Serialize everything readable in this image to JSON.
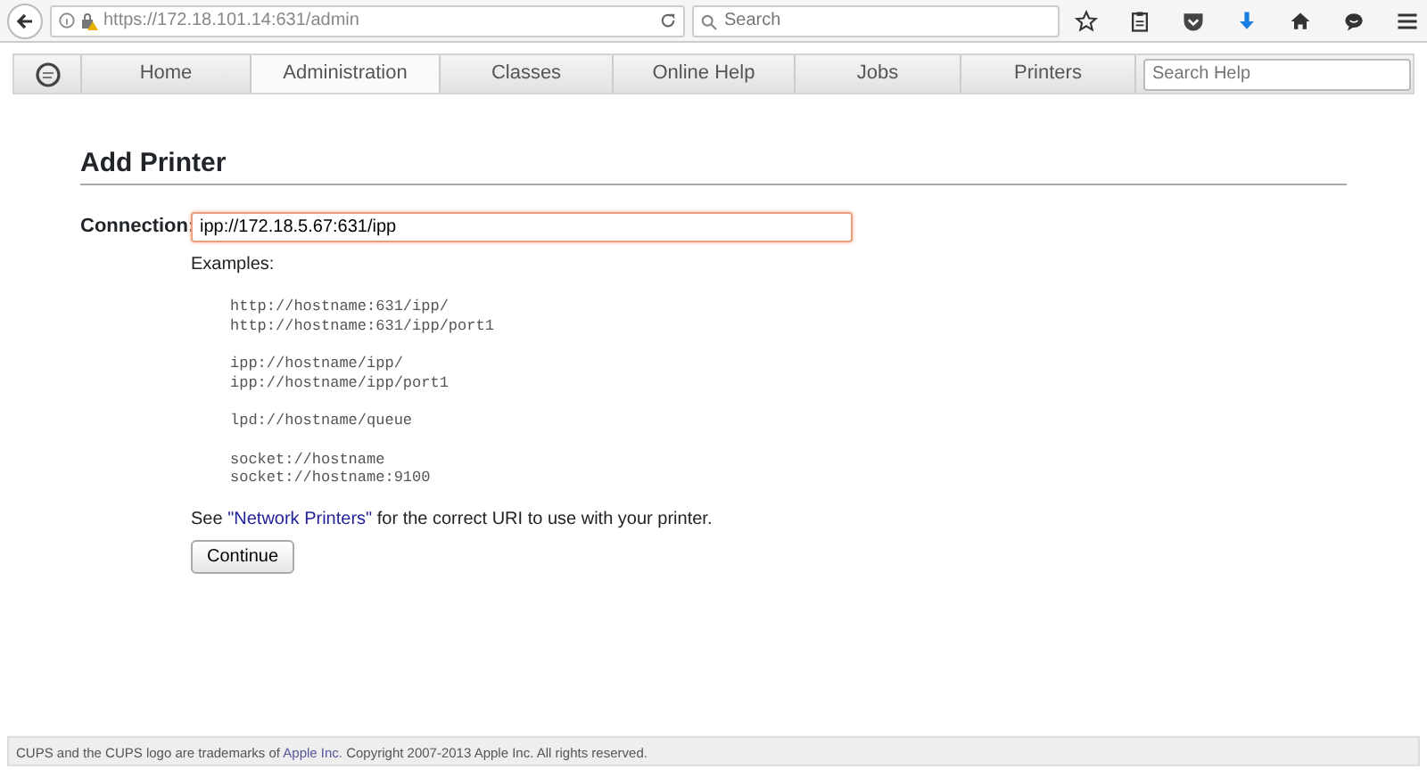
{
  "browser": {
    "url_host": "https://172.18.101.14",
    "url_path": ":631/admin",
    "search_placeholder": "Search"
  },
  "nav": {
    "tabs": [
      {
        "label": "Home",
        "selected": false
      },
      {
        "label": "Administration",
        "selected": true
      },
      {
        "label": "Classes",
        "selected": false
      },
      {
        "label": "Online Help",
        "selected": false
      },
      {
        "label": "Jobs",
        "selected": false
      },
      {
        "label": "Printers",
        "selected": false
      }
    ],
    "search_placeholder": "Search Help"
  },
  "heading": "Add Printer",
  "connection": {
    "label": "Connection:",
    "value": "ipp://172.18.5.67:631/ipp"
  },
  "examples_label": "Examples:",
  "examples": [
    [
      "http://hostname:631/ipp/",
      "http://hostname:631/ipp/port1"
    ],
    [
      "ipp://hostname/ipp/",
      "ipp://hostname/ipp/port1"
    ],
    [
      "lpd://hostname/queue"
    ],
    [
      "socket://hostname",
      "socket://hostname:9100"
    ]
  ],
  "note": {
    "before": "See ",
    "link": "\"Network Printers\"",
    "after": " for the correct URI to use with your printer."
  },
  "continue_button": "Continue",
  "footer": {
    "before": "CUPS and the CUPS logo are trademarks of ",
    "link": "Apple Inc.",
    "after": " Copyright 2007-2013 Apple Inc. All rights reserved."
  }
}
